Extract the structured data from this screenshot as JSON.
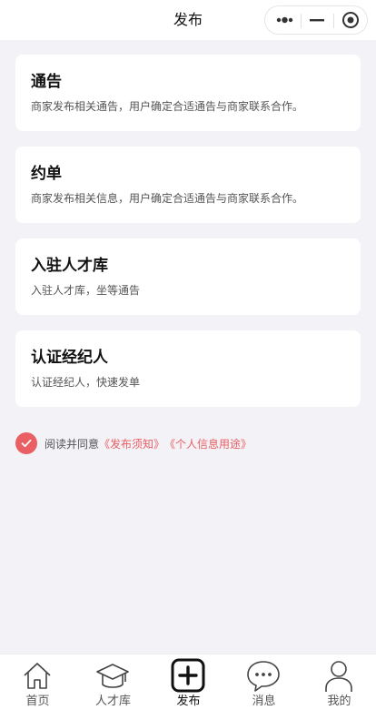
{
  "header": {
    "title": "发布"
  },
  "cards": [
    {
      "title": "通告",
      "desc": "商家发布相关通告，用户确定合适通告与商家联系合作。"
    },
    {
      "title": "约单",
      "desc": "商家发布相关信息，用户确定合适通告与商家联系合作。"
    },
    {
      "title": "入驻人才库",
      "desc": "入驻人才库，坐等通告"
    },
    {
      "title": "认证经纪人",
      "desc": "认证经纪人，快速发单"
    }
  ],
  "agreement": {
    "prefix": "阅读并同意",
    "link1": "《发布须知》",
    "link2": "《个人信息用途》",
    "accent_color": "#e95f63"
  },
  "tabbar": {
    "items": [
      {
        "label": "首页",
        "icon": "home-icon"
      },
      {
        "label": "人才库",
        "icon": "graduation-cap-icon"
      },
      {
        "label": "发布",
        "icon": "plus-square-icon",
        "active": true
      },
      {
        "label": "消息",
        "icon": "chat-bubble-icon"
      },
      {
        "label": "我的",
        "icon": "user-icon"
      }
    ]
  }
}
